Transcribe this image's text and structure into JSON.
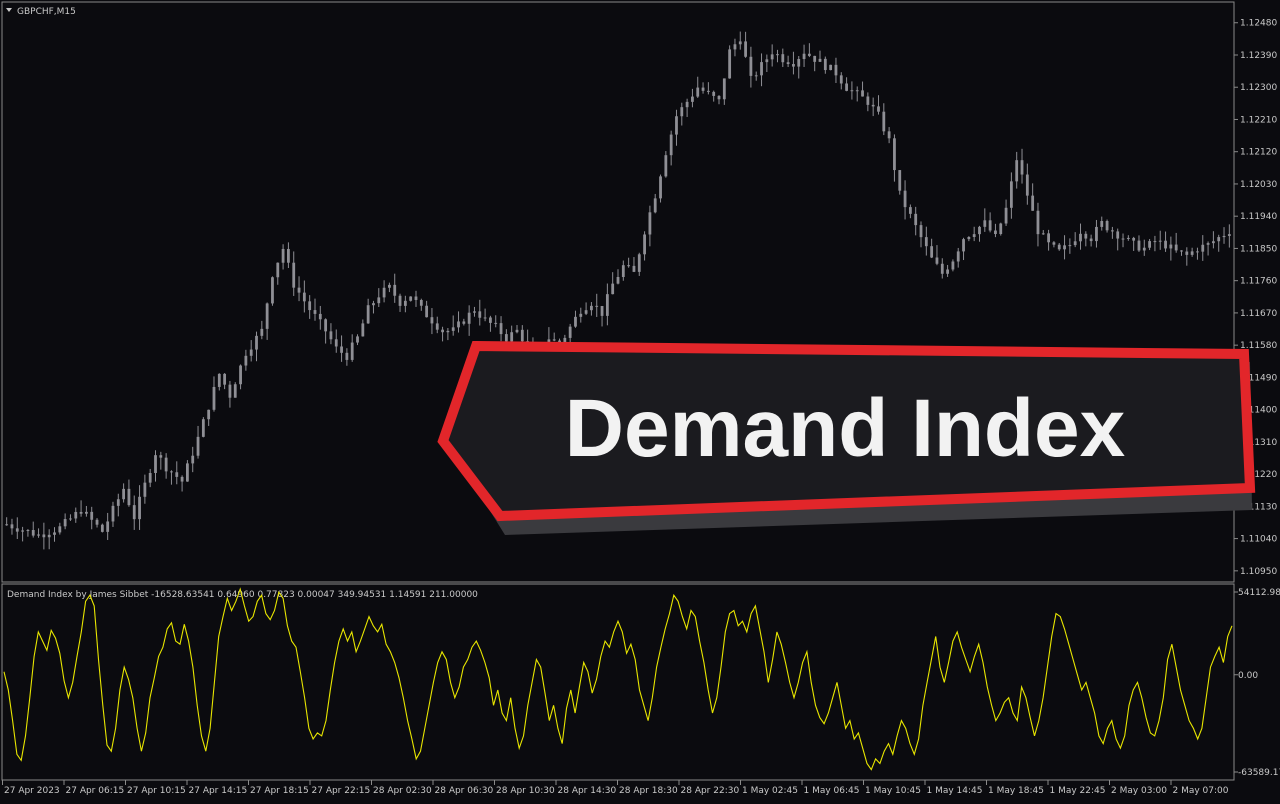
{
  "symbol_label": "GBPCHF,M15",
  "indicator_label": "Demand Index by James Sibbet -16528.63541 0.64960 0.77823 0.00047 349.94531 1.14591 211.00000",
  "banner": {
    "title": "Demand Index"
  },
  "colors": {
    "background": "#0b0b0f",
    "candle": "#8f8f95",
    "indicator": "#e8e600",
    "banner_border": "#e2262a",
    "banner_fill": "#1b1b1f",
    "axis_text": "#c9c9c9"
  },
  "chart_data": [
    {
      "type": "candlestick",
      "symbol": "GBPCHF",
      "timeframe": "M15",
      "price_ticks": [
        "1.12480",
        "1.12390",
        "1.12300",
        "1.12210",
        "1.12120",
        "1.12030",
        "1.11940",
        "1.11850",
        "1.11760",
        "1.11670",
        "1.11580",
        "1.11490",
        "1.11400",
        "1.11310",
        "1.11220",
        "1.11130",
        "1.11040",
        "1.10950"
      ],
      "ylim": [
        1.1093,
        1.1251
      ],
      "x_labels": [
        "27 Apr 2023",
        "27 Apr 06:15",
        "27 Apr 10:15",
        "27 Apr 14:15",
        "27 Apr 18:15",
        "27 Apr 22:15",
        "28 Apr 02:30",
        "28 Apr 06:30",
        "28 Apr 10:30",
        "28 Apr 14:30",
        "28 Apr 18:30",
        "28 Apr 22:30",
        "1 May 02:45",
        "1 May 06:45",
        "1 May 10:45",
        "1 May 14:45",
        "1 May 18:45",
        "1 May 22:45",
        "2 May 03:00",
        "2 May 07:00"
      ],
      "close_path": [
        [
          0,
          1.1108
        ],
        [
          6,
          1.1105
        ],
        [
          10,
          1.1107
        ],
        [
          14,
          1.1112
        ],
        [
          18,
          1.1106
        ],
        [
          22,
          1.1118
        ],
        [
          24,
          1.111
        ],
        [
          28,
          1.1128
        ],
        [
          30,
          1.1124
        ],
        [
          33,
          1.112
        ],
        [
          36,
          1.1132
        ],
        [
          40,
          1.115
        ],
        [
          42,
          1.1144
        ],
        [
          45,
          1.1156
        ],
        [
          48,
          1.1162
        ],
        [
          50,
          1.1178
        ],
        [
          52,
          1.1185
        ],
        [
          54,
          1.1175
        ],
        [
          57,
          1.1168
        ],
        [
          60,
          1.1162
        ],
        [
          62,
          1.1157
        ],
        [
          64,
          1.1155
        ],
        [
          66,
          1.116
        ],
        [
          68,
          1.1168
        ],
        [
          70,
          1.1172
        ],
        [
          72,
          1.1174
        ],
        [
          74,
          1.117
        ],
        [
          76,
          1.1172
        ],
        [
          78,
          1.1168
        ],
        [
          80,
          1.1165
        ],
        [
          82,
          1.1162
        ],
        [
          84,
          1.1162
        ],
        [
          86,
          1.1165
        ],
        [
          88,
          1.1168
        ],
        [
          90,
          1.1165
        ],
        [
          92,
          1.1163
        ],
        [
          94,
          1.116
        ],
        [
          96,
          1.1162
        ],
        [
          98,
          1.1158
        ],
        [
          100,
          1.1155
        ],
        [
          102,
          1.116
        ],
        [
          104,
          1.1158
        ],
        [
          106,
          1.1163
        ],
        [
          108,
          1.1168
        ],
        [
          110,
          1.117
        ],
        [
          112,
          1.1167
        ],
        [
          114,
          1.1175
        ],
        [
          116,
          1.118
        ],
        [
          118,
          1.1178
        ],
        [
          120,
          1.119
        ],
        [
          122,
          1.12
        ],
        [
          124,
          1.1212
        ],
        [
          126,
          1.1222
        ],
        [
          128,
          1.1226
        ],
        [
          130,
          1.123
        ],
        [
          132,
          1.1228
        ],
        [
          134,
          1.1226
        ],
        [
          136,
          1.124
        ],
        [
          138,
          1.1244
        ],
        [
          140,
          1.1232
        ],
        [
          142,
          1.1236
        ],
        [
          144,
          1.124
        ],
        [
          146,
          1.1238
        ],
        [
          148,
          1.1237
        ],
        [
          150,
          1.124
        ],
        [
          152,
          1.1238
        ],
        [
          154,
          1.1236
        ],
        [
          156,
          1.1234
        ],
        [
          158,
          1.123
        ],
        [
          160,
          1.1228
        ],
        [
          162,
          1.1226
        ],
        [
          164,
          1.1222
        ],
        [
          166,
          1.1215
        ],
        [
          168,
          1.12
        ],
        [
          170,
          1.1194
        ],
        [
          172,
          1.1188
        ],
        [
          174,
          1.1182
        ],
        [
          176,
          1.1178
        ],
        [
          178,
          1.1182
        ],
        [
          180,
          1.1188
        ],
        [
          182,
          1.119
        ],
        [
          184,
          1.1192
        ],
        [
          186,
          1.1188
        ],
        [
          188,
          1.1196
        ],
        [
          190,
          1.121
        ],
        [
          192,
          1.12
        ],
        [
          194,
          1.119
        ],
        [
          196,
          1.1186
        ],
        [
          198,
          1.1184
        ],
        [
          200,
          1.1186
        ],
        [
          202,
          1.119
        ],
        [
          204,
          1.1188
        ],
        [
          206,
          1.1192
        ],
        [
          208,
          1.119
        ],
        [
          210,
          1.1188
        ],
        [
          212,
          1.1186
        ],
        [
          214,
          1.1185
        ],
        [
          216,
          1.1187
        ],
        [
          218,
          1.1186
        ],
        [
          220,
          1.1184
        ],
        [
          222,
          1.1183
        ],
        [
          224,
          1.1185
        ],
        [
          226,
          1.1186
        ],
        [
          228,
          1.1188
        ],
        [
          230,
          1.119
        ]
      ],
      "n_candles": 231
    },
    {
      "type": "line",
      "name": "Demand Index",
      "y_ticks": [
        "54112.985",
        "0.00",
        "-63589.176"
      ],
      "ylim": [
        -63589.176,
        54112.985
      ],
      "values": [
        2000,
        -10000,
        -30000,
        -52000,
        -56000,
        -40000,
        -15000,
        12000,
        28000,
        22000,
        16000,
        29000,
        24000,
        14000,
        -4000,
        -15000,
        -5000,
        12000,
        28000,
        48000,
        52000,
        45000,
        10000,
        -20000,
        -46000,
        -50000,
        -35000,
        -10000,
        5000,
        -3000,
        -15000,
        -35000,
        -50000,
        -38000,
        -15000,
        -2000,
        12000,
        18000,
        30000,
        34000,
        22000,
        20000,
        33000,
        22000,
        5000,
        -20000,
        -40000,
        -50000,
        -35000,
        -5000,
        25000,
        38000,
        50000,
        42000,
        48000,
        56000,
        45000,
        35000,
        38000,
        48000,
        52000,
        40000,
        36000,
        42000,
        54000,
        50000,
        32000,
        22000,
        18000,
        2000,
        -15000,
        -35000,
        -42000,
        -38000,
        -40000,
        -30000,
        -10000,
        8000,
        22000,
        30000,
        22000,
        28000,
        15000,
        22000,
        30000,
        38000,
        32000,
        28000,
        33000,
        20000,
        15000,
        8000,
        -2000,
        -15000,
        -30000,
        -42000,
        -55000,
        -50000,
        -35000,
        -20000,
        -5000,
        8000,
        15000,
        10000,
        -5000,
        -15000,
        -8000,
        5000,
        10000,
        18000,
        22000,
        16000,
        8000,
        -2000,
        -20000,
        -10000,
        -25000,
        -30000,
        -15000,
        -35000,
        -48000,
        -40000,
        -20000,
        -5000,
        10000,
        5000,
        -12000,
        -30000,
        -20000,
        -35000,
        -45000,
        -22000,
        -10000,
        -25000,
        -8000,
        8000,
        2000,
        -12000,
        -3000,
        12000,
        22000,
        18000,
        28000,
        35000,
        28000,
        14000,
        20000,
        10000,
        -10000,
        -20000,
        -30000,
        -15000,
        5000,
        18000,
        30000,
        40000,
        52000,
        48000,
        38000,
        30000,
        42000,
        38000,
        22000,
        8000,
        -10000,
        -25000,
        -15000,
        5000,
        28000,
        40000,
        42000,
        32000,
        35000,
        28000,
        40000,
        45000,
        30000,
        15000,
        -5000,
        10000,
        28000,
        20000,
        8000,
        -5000,
        -15000,
        -5000,
        8000,
        15000,
        -5000,
        -20000,
        -28000,
        -32000,
        -25000,
        -15000,
        -5000,
        -20000,
        -35000,
        -30000,
        -42000,
        -38000,
        -48000,
        -58000,
        -62000,
        -55000,
        -58000,
        -50000,
        -45000,
        -52000,
        -40000,
        -30000,
        -35000,
        -45000,
        -52000,
        -42000,
        -20000,
        -5000,
        10000,
        25000,
        5000,
        -5000,
        8000,
        22000,
        28000,
        18000,
        10000,
        2000,
        12000,
        20000,
        8000,
        -8000,
        -20000,
        -30000,
        -25000,
        -18000,
        -15000,
        -25000,
        -30000,
        -8000,
        -15000,
        -28000,
        -40000,
        -30000,
        -15000,
        5000,
        25000,
        40000,
        38000,
        30000,
        20000,
        10000,
        0,
        -10000,
        -5000,
        -15000,
        -25000,
        -40000,
        -45000,
        -35000,
        -30000,
        -42000,
        -48000,
        -40000,
        -20000,
        -10000,
        -5000,
        -15000,
        -28000,
        -38000,
        -40000,
        -30000,
        -15000,
        10000,
        20000,
        5000,
        -10000,
        -20000,
        -30000,
        -35000,
        -42000,
        -35000,
        -15000,
        5000,
        12000,
        18000,
        8000,
        25000,
        32000
      ]
    }
  ]
}
